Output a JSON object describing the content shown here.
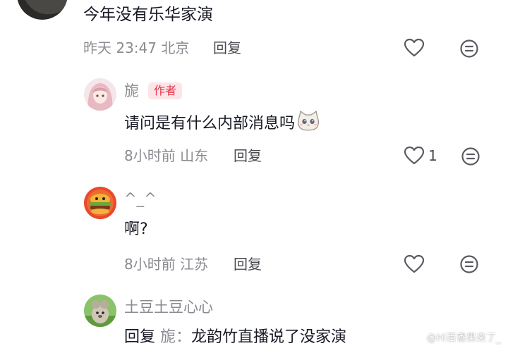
{
  "comment": {
    "text": "今年没有乐华家演",
    "time": "昨天 23:47",
    "location": "北京",
    "reply_label": "回复"
  },
  "replies": [
    {
      "username": "旎",
      "author_tag": "作者",
      "text": "请问是有什么内部消息吗",
      "emoji": "cat-face-emoji",
      "time": "8小时前",
      "location": "山东",
      "reply_label": "回复",
      "like_count": "1"
    },
    {
      "username": "^_^",
      "text": "啊?",
      "time": "8小时前",
      "location": "江苏",
      "reply_label": "回复"
    },
    {
      "username": "土豆土豆心心",
      "reply_prefix": "回复",
      "reply_to": "旎：",
      "text": "龙韵竹直播说了没家演"
    }
  ],
  "watermark": "@Hi百香果来了_",
  "icons": {
    "like": "heart-outline-icon",
    "dislike": "neutral-face-icon"
  },
  "colors": {
    "author_tag_bg": "#fde4e6",
    "author_tag_text": "#e2344b",
    "meta": "#8a8b91",
    "text": "#161823"
  }
}
